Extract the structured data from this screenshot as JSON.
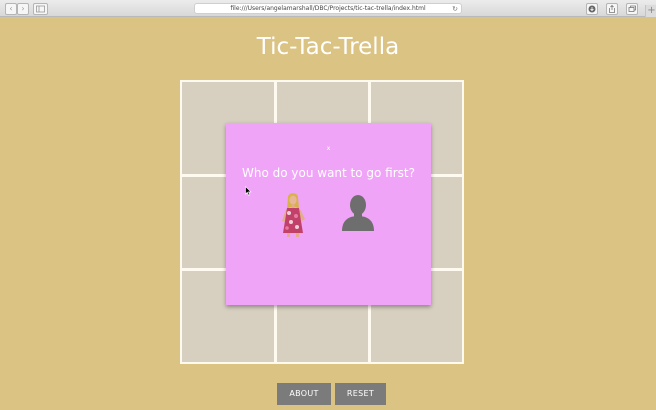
{
  "browser": {
    "url": "file:///Users/angelamarshall/DBC/Projects/tic-tac-trella/index.html",
    "back_icon": "chevron-left-icon",
    "forward_icon": "chevron-right-icon",
    "sidebar_icon": "sidebar-icon",
    "reload_icon": "reload-icon",
    "download_icon": "download-icon",
    "share_icon": "share-icon",
    "tabs_icon": "tabs-icon",
    "new_tab_icon": "plus-icon"
  },
  "page": {
    "title": "Tic-Tac-Trella"
  },
  "board": {
    "cells": 9,
    "cell_color": "#d7cfc0",
    "line_color": "#fffaf0"
  },
  "modal": {
    "close_label": "x",
    "question": "Who do you want to go first?",
    "choices": [
      {
        "name": "trella-avatar-choice",
        "icon": "person-photo"
      },
      {
        "name": "player-silhouette-choice",
        "icon": "person-silhouette-icon"
      }
    ],
    "background": "#f0a4f8"
  },
  "buttons": {
    "about_label": "ABOUT",
    "reset_label": "RESET"
  },
  "colors": {
    "page_background": "#dbc384",
    "button_background": "#7b7b7b"
  }
}
